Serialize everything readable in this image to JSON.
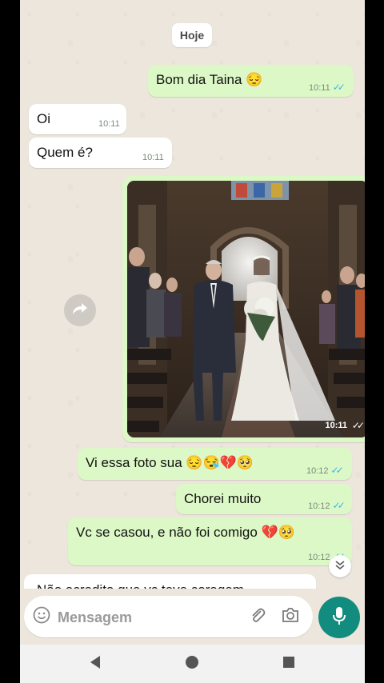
{
  "top_partial_text": "",
  "date_label": "Hoje",
  "messages": [
    {
      "text": "Bom dia Taina 😔",
      "time": "10:11",
      "ticks": "✓✓"
    },
    {
      "text": "Oi",
      "time": "10:11"
    },
    {
      "text": "Quem é?",
      "time": "10:11"
    },
    {
      "time": "10:11",
      "ticks": "✓✓"
    },
    {
      "text": "Vi essa foto sua 😔😪💔🥺",
      "time": "10:12",
      "ticks": "✓✓"
    },
    {
      "text": "Chorei muito",
      "time": "10:12",
      "ticks": "✓✓"
    },
    {
      "text": "Vc se casou, e não foi comigo 💔🥺",
      "time": "10:12",
      "ticks": "✓✓"
    },
    {
      "text": "Não acredito que vc teve coragem"
    }
  ],
  "input": {
    "placeholder": "Mensagem"
  },
  "colors": {
    "outgoing": "#dcf8c6",
    "incoming": "#ffffff",
    "accent": "#128c7e",
    "read_ticks": "#34b7f1"
  },
  "icons": [
    "forward-icon",
    "chevron-down-icon",
    "emoji-icon",
    "attach-icon",
    "camera-icon",
    "mic-icon",
    "back-icon",
    "home-icon",
    "recents-icon"
  ]
}
